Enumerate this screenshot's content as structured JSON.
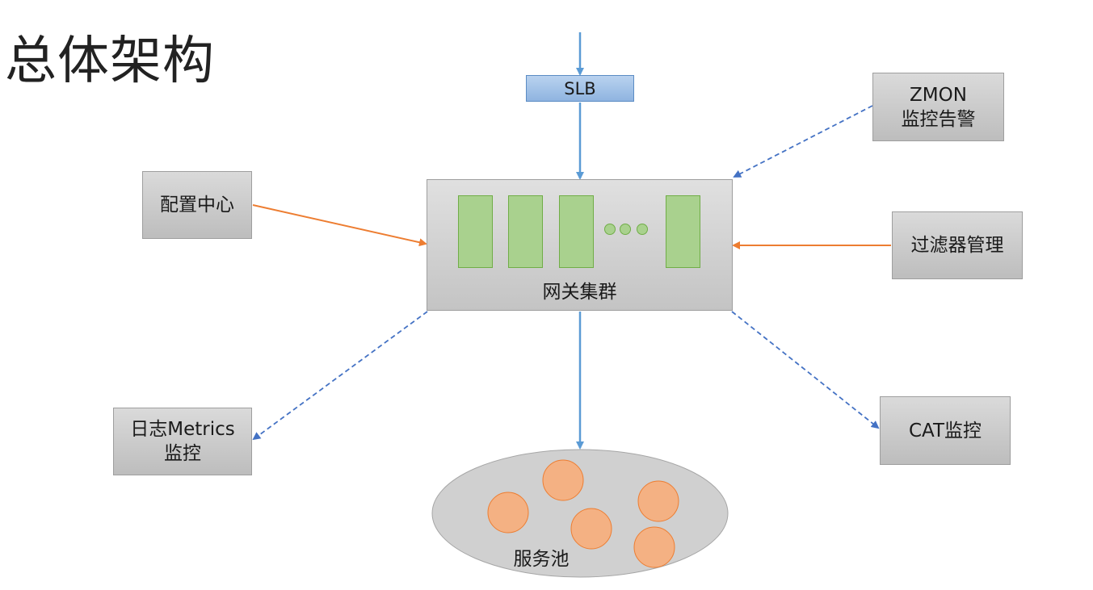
{
  "title": "总体架构",
  "slb": "SLB",
  "gateway_cluster": "网关集群",
  "zmon": {
    "line1": "ZMON",
    "line2": "监控告警"
  },
  "config_center": "配置中心",
  "filter_mgmt": "过滤器管理",
  "metrics": {
    "line1": "日志Metrics",
    "line2": "监控"
  },
  "cat": "CAT监控",
  "service_pool": "服务池",
  "colors": {
    "blue_arrow": "#5b9bd5",
    "orange_arrow": "#ed7d31",
    "dashed_arrow": "#4472c4",
    "node_green": "#a9d18e",
    "service_orange": "#f4b183"
  }
}
